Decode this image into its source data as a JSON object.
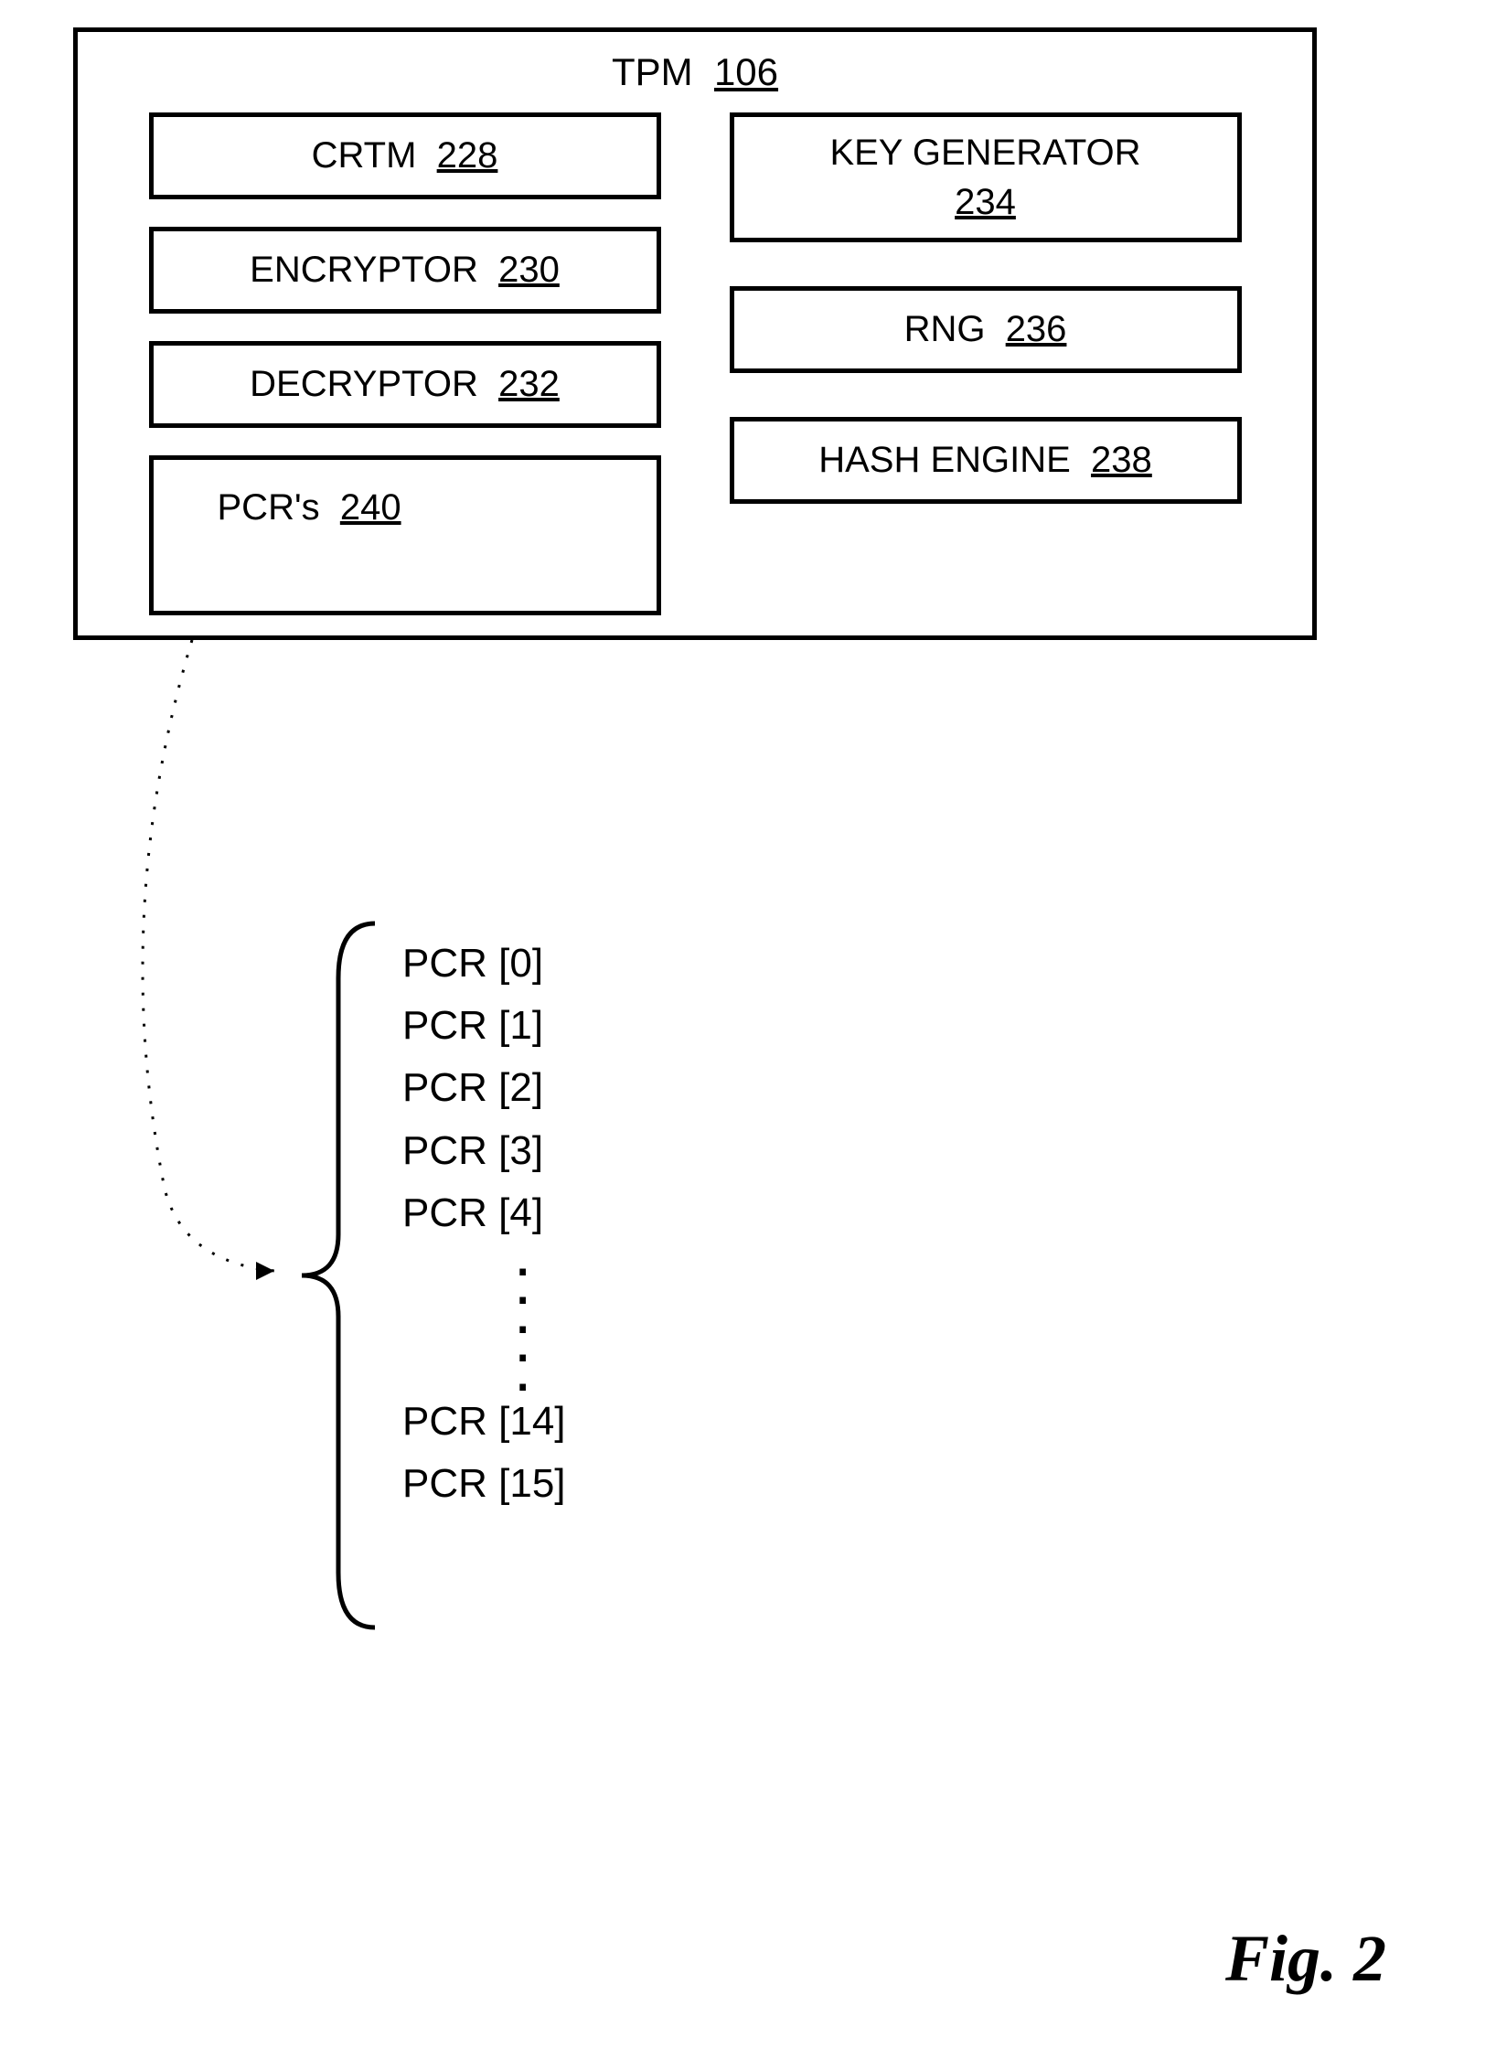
{
  "tpm": {
    "title_label": "TPM",
    "title_ref": "106",
    "left_modules": [
      {
        "label": "CRTM",
        "ref": "228"
      },
      {
        "label": "ENCRYPTOR",
        "ref": "230"
      },
      {
        "label": "DECRYPTOR",
        "ref": "232"
      },
      {
        "label": "PCR's",
        "ref": "240"
      }
    ],
    "right_modules": [
      {
        "label": "KEY GENERATOR",
        "ref": "234"
      },
      {
        "label": "RNG",
        "ref": "236"
      },
      {
        "label": "HASH ENGINE",
        "ref": "238"
      }
    ]
  },
  "pcr_detail": {
    "items_top": [
      "PCR [0]",
      "PCR [1]",
      "PCR [2]",
      "PCR [3]",
      "PCR [4]"
    ],
    "items_bottom": [
      "PCR [14]",
      "PCR [15]"
    ]
  },
  "figure_caption": "Fig. 2"
}
